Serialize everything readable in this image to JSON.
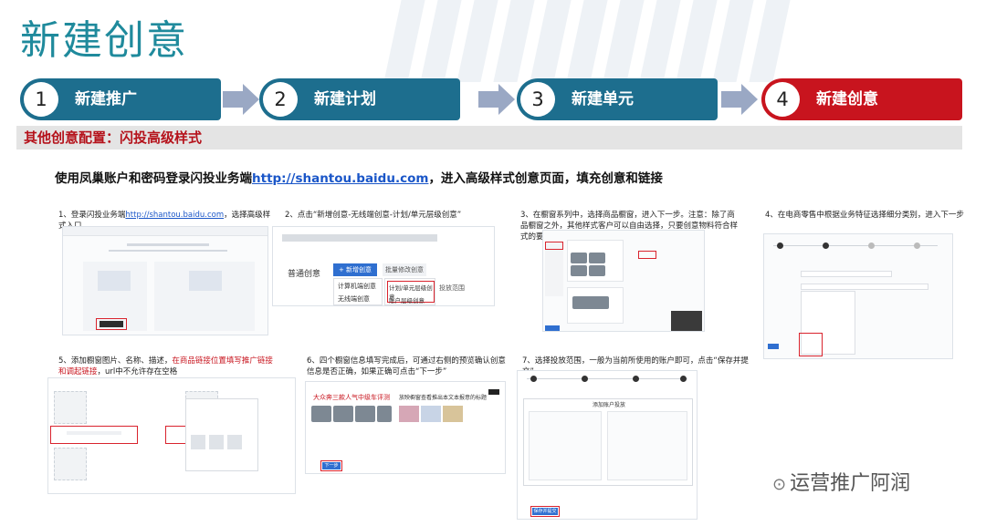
{
  "title": "新建创意",
  "steps": [
    {
      "num": "1",
      "label": "新建推广"
    },
    {
      "num": "2",
      "label": "新建计划"
    },
    {
      "num": "3",
      "label": "新建单元"
    },
    {
      "num": "4",
      "label": "新建创意"
    }
  ],
  "section": "其他创意配置：闪投高级样式",
  "intro": {
    "prefix": "使用凤巢账户和密码登录闪投业务端",
    "link": "http://shantou.baidu.com",
    "suffix": "，进入高级样式创意页面，填充创意和链接"
  },
  "captions": {
    "c1_prefix": "1、登录闪投业务端",
    "c1_link": "http://shantou.baidu.com",
    "c1_suffix": "，选择高级样式入口",
    "c2": "2、点击“新增创意-无线端创意-计划/单元层级创意”",
    "c3": "3、在橱窗系列中，选择商品橱窗，进入下一步。注意：除了商品橱窗之外，其他样式客户可以自由选择，只要创意物料符合样式的要求",
    "c4": "4、在电商零售中根据业务特征选择细分类别，进入下一步",
    "c5_prefix": "5、添加橱窗图片、名称、描述，",
    "c5_red": "在商品链接位置填写推广链接和调起链接",
    "c5_suffix": "，url中不允许存在空格",
    "c6": "6、四个橱窗信息填写完成后，可通过右侧的预览确认创意信息是否正确，如果正确可点击“下一步”",
    "c7": "7、选择投放范围，一般为当前所使用的账户即可，点击“保存并提交”"
  },
  "shot2": {
    "menu_label": "普通创意",
    "add_button": "+ 新增创意",
    "bulk_edit": "批量修改创意",
    "pc_label": "计算机端创意",
    "mobile_label": "无线端创意",
    "plan_unit": "计划/单元层级创意",
    "account_level": "账户层级创意",
    "scope_label": "投放范围"
  },
  "shot6": {
    "title_left": "大众奔三款人气中级车评测",
    "title_right": "放映橱窗查看推出本文本报意的标题",
    "next_btn": "下一步"
  },
  "shot7": {
    "panel_title": "添加账户投放",
    "save_btn": "保存并提交"
  },
  "watermark": "运营推广阿润"
}
